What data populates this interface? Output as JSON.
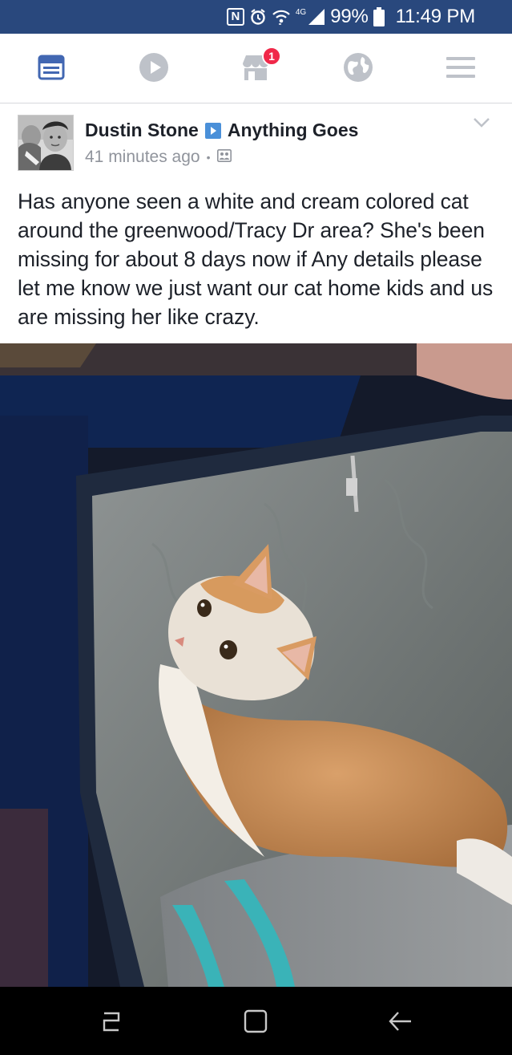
{
  "status_bar": {
    "network_label": "4G",
    "battery_percent": "99%",
    "time": "11:49 PM",
    "icons": [
      "nfc-icon",
      "alarm-icon",
      "wifi-icon",
      "signal-icon",
      "battery-icon"
    ]
  },
  "tab_bar": {
    "tabs": [
      {
        "name": "news-feed",
        "icon": "news-feed-icon",
        "active": true
      },
      {
        "name": "video",
        "icon": "play-icon",
        "active": false
      },
      {
        "name": "marketplace",
        "icon": "marketplace-icon",
        "active": false,
        "badge": "1"
      },
      {
        "name": "notifications",
        "icon": "globe-icon",
        "active": false
      },
      {
        "name": "menu",
        "icon": "hamburger-icon",
        "active": false
      }
    ],
    "active_color": "#4267b2",
    "inactive_color": "#bec2c9",
    "badge_color": "#f02849"
  },
  "post": {
    "author": "Dustin Stone",
    "group": "Anything Goes",
    "timestamp": "41 minutes ago",
    "separator": "•",
    "privacy_icon": "group-icon",
    "text": "Has anyone seen a white and cream colored cat around the greenwood/Tracy Dr area? She's been missing for about 8 days now if Any details please let me know we just want our cat home kids and us are missing her like crazy.",
    "photo_icon": "cat-in-suitcase-photo"
  },
  "nav_bar": {
    "buttons": [
      "recent-apps-icon",
      "home-icon",
      "back-icon"
    ]
  }
}
